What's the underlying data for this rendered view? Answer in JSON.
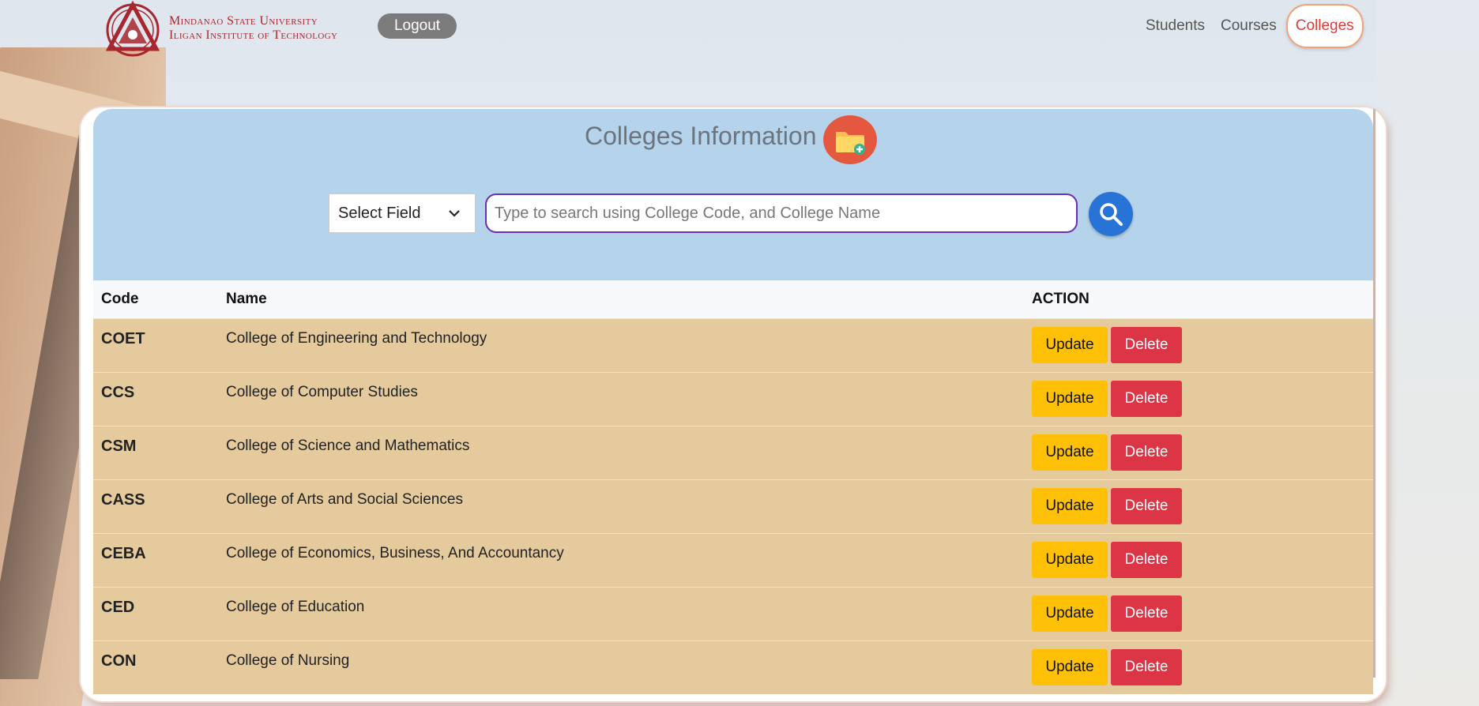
{
  "header": {
    "logo_line1": "Mindanao State University",
    "logo_line2": "Iligan Institute of Technology",
    "logout_label": "Logout",
    "nav": [
      "Students",
      "Courses"
    ],
    "nav_active": "Colleges"
  },
  "main": {
    "title": "Colleges Information",
    "select_label": "Select Field",
    "search_placeholder": "Type to search using College Code, and College Name",
    "columns": [
      "Code",
      "Name",
      "ACTION"
    ],
    "update_label": "Update",
    "delete_label": "Delete",
    "rows": [
      {
        "code": "COET",
        "name": "College of Engineering and Technology"
      },
      {
        "code": "CCS",
        "name": "College of Computer Studies"
      },
      {
        "code": "CSM",
        "name": "College of Science and Mathematics"
      },
      {
        "code": "CASS",
        "name": "College of Arts and Social Sciences"
      },
      {
        "code": "CEBA",
        "name": "College of Economics, Business, And Accountancy"
      },
      {
        "code": "CED",
        "name": "College of Education"
      },
      {
        "code": "CON",
        "name": "College of Nursing"
      }
    ]
  },
  "colors": {
    "accent_active": "#e03b3b",
    "panel": "#b5d3ea",
    "row_bg": "#e5ca9d",
    "update": "#ffc107",
    "delete": "#dc3545",
    "search_button": "#2874d6",
    "add_button": "#e55840"
  },
  "icons": {
    "logo": "msu-iit-logo",
    "add": "folder-add-icon",
    "search": "search-icon",
    "select": "chevron-down-icon"
  }
}
